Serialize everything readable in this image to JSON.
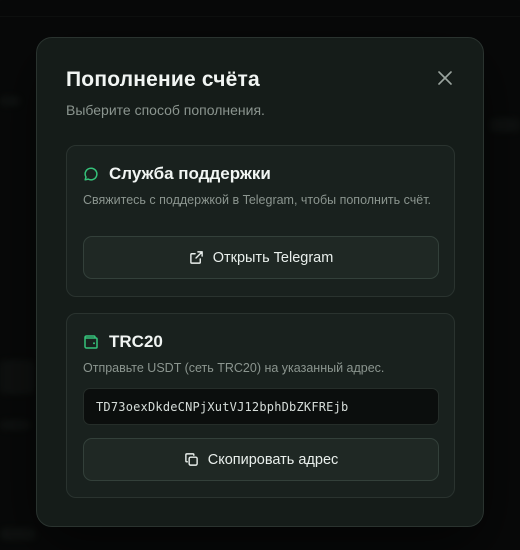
{
  "modal": {
    "title": "Пополнение счёта",
    "subtitle": "Выберите способ пополнения."
  },
  "support": {
    "title": "Служба поддержки",
    "description": "Свяжитесь с поддержкой в Telegram, чтобы пополнить счёт.",
    "button_label": "Открыть Telegram",
    "icon": "chat-bubble-icon",
    "button_icon": "external-link-icon"
  },
  "trc20": {
    "title": "TRC20",
    "description": "Отправьте USDT (сеть TRC20) на указанный адрес.",
    "address": "TD73oexDkdeCNPjXutVJ12bphDbZKFREjb",
    "button_label": "Скопировать адрес",
    "icon": "wallet-icon",
    "button_icon": "copy-icon"
  },
  "colors": {
    "accent": "#35c27a",
    "background": "#0c0e0d",
    "modal": "#151c19",
    "card": "#19211e"
  }
}
